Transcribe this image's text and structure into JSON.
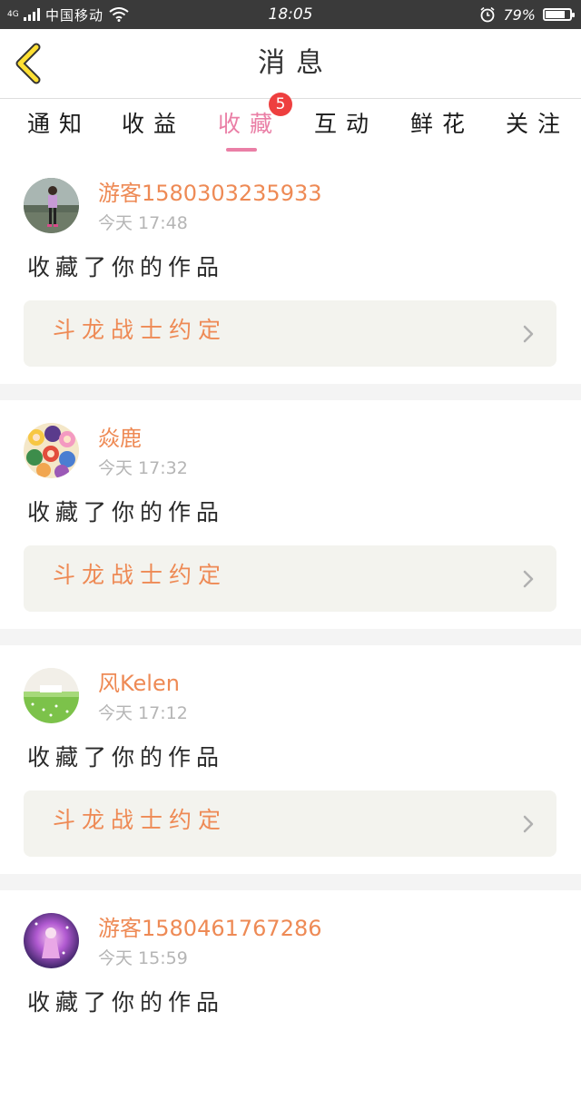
{
  "status_bar": {
    "network": "4G",
    "carrier": "中国移动",
    "time": "18:05",
    "battery": "79%",
    "battery_level": 0.79
  },
  "header": {
    "title": "消息",
    "back_icon": "chevron-left-icon",
    "accent_color": "#ffe033"
  },
  "tabs": [
    {
      "label": "通知"
    },
    {
      "label": "收益"
    },
    {
      "label": "收藏",
      "active": true
    },
    {
      "label": "互动"
    },
    {
      "label": "鲜花"
    },
    {
      "label": "关注"
    }
  ],
  "badge": {
    "count": "5",
    "color": "#ee3f3f"
  },
  "colors": {
    "active_tab": "#ea7fa6",
    "username": "#ee8a55",
    "work_title": "#ee8a55",
    "card_bg": "#f3f3ee"
  },
  "items": [
    {
      "username": "游客1580303235933",
      "time": "今天 17:48",
      "message": "收藏了你的作品",
      "work_title": "斗龙战士约定"
    },
    {
      "username": "焱鹿",
      "time": "今天 17:32",
      "message": "收藏了你的作品",
      "work_title": "斗龙战士约定"
    },
    {
      "username": "风Kelen",
      "time": "今天 17:12",
      "message": "收藏了你的作品",
      "work_title": "斗龙战士约定"
    },
    {
      "username": "游客1580461767286",
      "time": "今天 15:59",
      "message": "收藏了你的作品"
    }
  ]
}
